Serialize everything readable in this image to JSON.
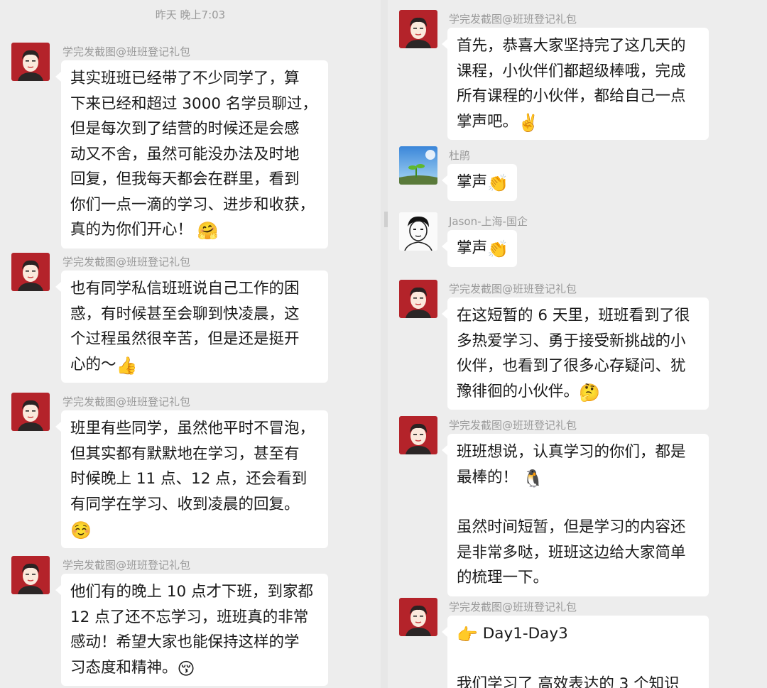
{
  "left": {
    "timestamp": "昨天 晚上7:03",
    "messages": [
      {
        "sender": "学完发截图@班班登记礼包",
        "lines": [
          "其实班班已经带了不少同学了，算",
          "下来已经和超过 3000 名学员聊过，",
          "但是每次到了结营的时候还是会感",
          "动又不舍，虽然可能没办法及时地",
          "回复，但我每天都会在群里，看到",
          "你们一点一滴的学习、进步和收获，",
          "真的为你们开心！"
        ],
        "emoji": "🤗"
      },
      {
        "sender": "学完发截图@班班登记礼包",
        "lines": [
          "也有同学私信班班说自己工作的困",
          "惑，有时候甚至会聊到快凌晨，这",
          "个过程虽然很辛苦，但是还是挺开",
          "心的～"
        ],
        "emoji": "👍"
      },
      {
        "sender": "学完发截图@班班登记礼包",
        "lines": [
          "班里有些同学，虽然他平时不冒泡，",
          "但其实都有默默地在学习，甚至有",
          "时候晚上 11 点、12 点，还会看到",
          "有同学在学习、收到凌晨的回复。"
        ],
        "emoji": "☺️"
      },
      {
        "sender": "学完发截图@班班登记礼包",
        "lines": [
          "他们有的晚上 10 点才下班，到家都",
          "12 点了还不忘学习，班班真的非常",
          "感动！希望大家也能保持这样的学",
          "习态度和精神。"
        ],
        "emoji": "😚"
      }
    ]
  },
  "right": {
    "messages": [
      {
        "sender": "学完发截图@班班登记礼包",
        "lines": [
          "首先，恭喜大家坚持完了这几天的",
          "课程，小伙伴们都超级棒哦，完成",
          "所有课程的小伙伴，都给自己一点",
          "掌声吧。"
        ],
        "emoji": "✌️"
      },
      {
        "sender": "杜鹃",
        "lines": [
          "掌声"
        ],
        "emoji": "👏"
      },
      {
        "sender": "Jason-上海-国企",
        "lines": [
          "掌声"
        ],
        "emoji": "👏"
      },
      {
        "sender": "学完发截图@班班登记礼包",
        "lines": [
          "在这短暂的 6 天里，班班看到了很",
          "多热爱学习、勇于接受新挑战的小",
          "伙伴，也看到了很多心存疑问、犹",
          "豫徘徊的小伙伴。"
        ],
        "emoji": "🤔"
      },
      {
        "sender": "学完发截图@班班登记礼包",
        "lines_a": [
          "班班想说，认真学习的你们，都是",
          "最棒的！"
        ],
        "emoji": "🐧",
        "lines_b": [
          "虽然时间短暂，但是学习的内容还",
          "是非常多哒，班班这边给大家简单",
          "的梳理一下。"
        ]
      },
      {
        "sender": "学完发截图@班班登记礼包",
        "head_emoji": "👉",
        "lines": [
          "Day1-Day3"
        ],
        "lines_b": [
          "我们学习了 高效表达的 3 个知识"
        ]
      }
    ]
  },
  "colors": {
    "background": "#ededed",
    "bubble": "#ffffff",
    "avatar_bg": "#b4232a",
    "name_text": "#9a9a9a"
  }
}
